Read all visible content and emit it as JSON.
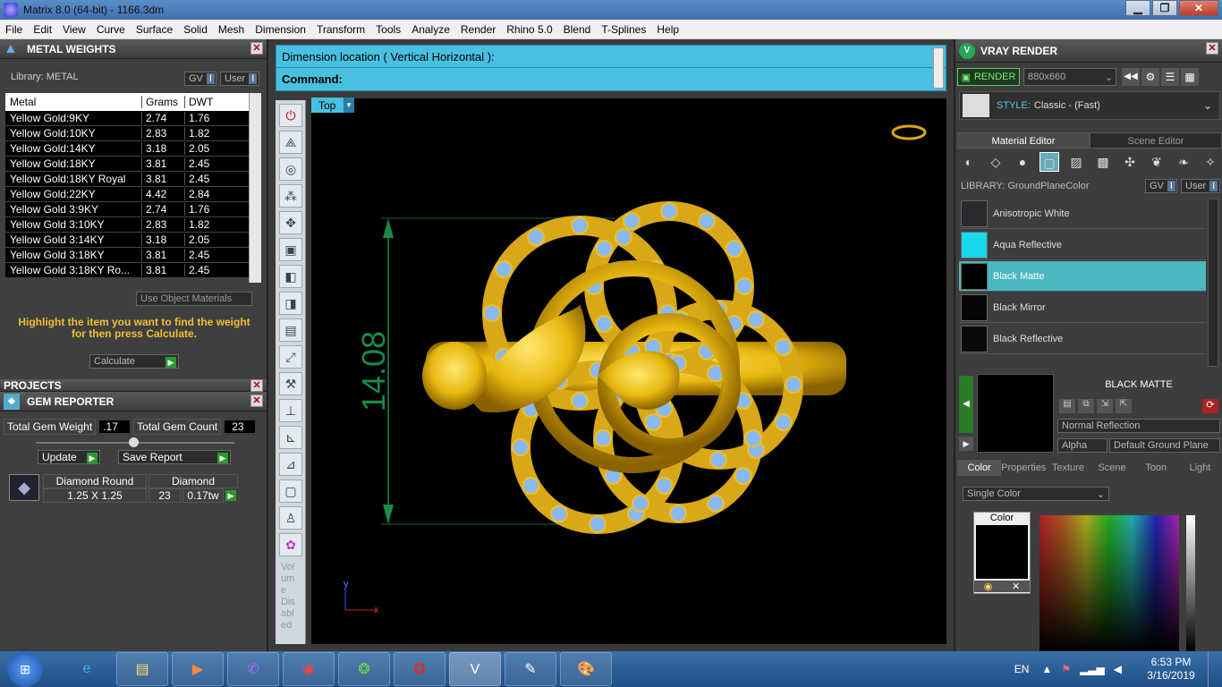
{
  "window": {
    "title": "Matrix 8.0 (64-bit) - 1166.3dm",
    "min": "▁",
    "max": "❐",
    "close": "✕"
  },
  "menu": [
    "File",
    "Edit",
    "View",
    "Curve",
    "Surface",
    "Solid",
    "Mesh",
    "Dimension",
    "Transform",
    "Tools",
    "Analyze",
    "Render",
    "Rhino 5.0",
    "Blend",
    "T-Splines",
    "Help"
  ],
  "metal": {
    "title": "METAL WEIGHTS",
    "library": "Library: METAL",
    "gv": "GV",
    "user": "User",
    "headers": [
      "Metal",
      "Grams",
      "DWT"
    ],
    "rows": [
      [
        "Yellow Gold:9KY",
        "2.74",
        "1.76"
      ],
      [
        "Yellow Gold:10KY",
        "2.83",
        "1.82"
      ],
      [
        "Yellow Gold:14KY",
        "3.18",
        "2.05"
      ],
      [
        "Yellow Gold:18KY",
        "3.81",
        "2.45"
      ],
      [
        "Yellow Gold:18KY Royal",
        "3.81",
        "2.45"
      ],
      [
        "Yellow Gold:22KY",
        "4.42",
        "2.84"
      ],
      [
        "Yellow Gold 3:9KY",
        "2.74",
        "1.76"
      ],
      [
        "Yellow Gold 3:10KY",
        "2.83",
        "1.82"
      ],
      [
        "Yellow Gold 3:14KY",
        "3.18",
        "2.05"
      ],
      [
        "Yellow Gold 3:18KY",
        "3.81",
        "2.45"
      ],
      [
        "Yellow Gold 3:18KY Ro...",
        "3.81",
        "2.45"
      ]
    ],
    "use_object": "Use Object Materials",
    "hint": "Highlight the item you want to find the weight for then press Calculate.",
    "calculate": "Calculate"
  },
  "projects": {
    "title": "PROJECTS"
  },
  "gem": {
    "title": "GEM REPORTER",
    "total_weight_label": "Total Gem Weight",
    "total_weight": ".17",
    "total_count_label": "Total Gem Count",
    "total_count": "23",
    "update": "Update",
    "save": "Save Report",
    "col1": "Diamond Round",
    "col2": "Diamond",
    "size": "1.25 X 1.25",
    "count": "23",
    "weight": "0.17tw"
  },
  "command": {
    "line1": "Dimension location ( Vertical  Horizontal ):",
    "line2": "Command:"
  },
  "viewport": {
    "label": "Top",
    "dimension": "14.08",
    "axis_y": "y",
    "axis_x": "x"
  },
  "toolbar_text": "Vol um e Dis abl ed",
  "vray": {
    "title": "VRAY RENDER",
    "render": "RENDER",
    "resolution": "880x660",
    "style_label": "STYLE:",
    "style": "Classic - (Fast)",
    "tab1": "Material Editor",
    "tab2": "Scene Editor",
    "library": "LIBRARY: GroundPlaneColor",
    "gv": "GV",
    "user": "User",
    "materials": [
      {
        "name": "Anisotropic White",
        "color": "#2a2a2e"
      },
      {
        "name": "Aqua Reflective",
        "color": "#18d8ec"
      },
      {
        "name": "Black Matte",
        "color": "#000000"
      },
      {
        "name": "Black Mirror",
        "color": "#050505"
      },
      {
        "name": "Black Reflective",
        "color": "#0a0a0a"
      }
    ],
    "selected": "BLACK MATTE",
    "reflection": "Normal Reflection",
    "alpha": "Alpha",
    "ground": "Default Ground Plane",
    "btabs": [
      "Color",
      "Properties",
      "Texture",
      "Scene",
      "Toon",
      "Light"
    ],
    "single_color": "Single Color",
    "color_label": "Color"
  },
  "taskbar": {
    "lang": "EN",
    "time": "6:53 PM",
    "date": "3/16/2019"
  }
}
